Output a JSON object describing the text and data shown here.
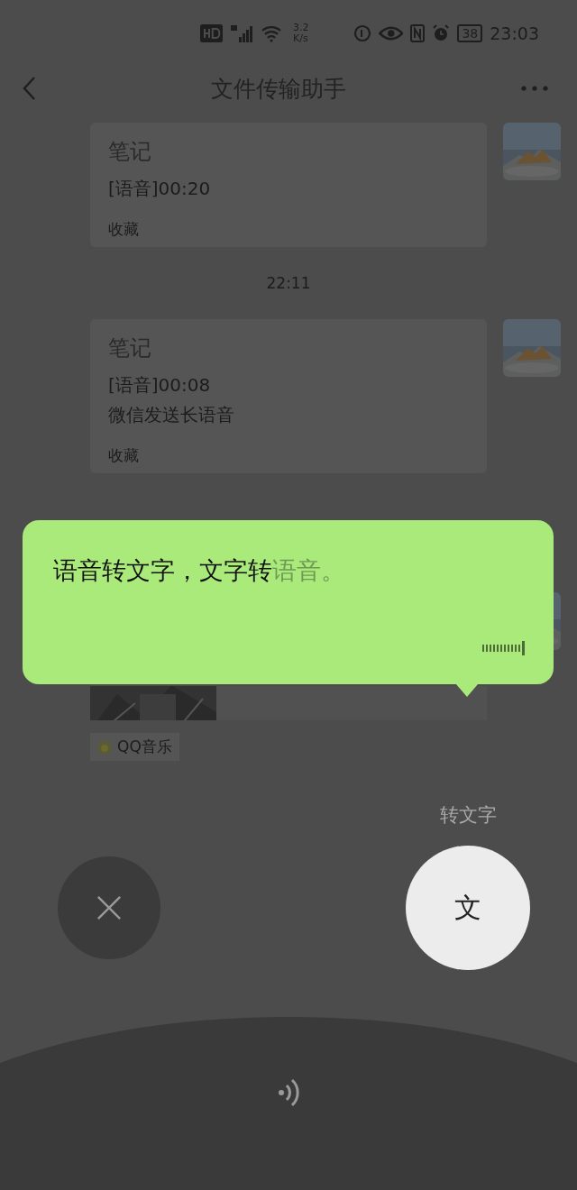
{
  "status_bar": {
    "speed": [
      "3.2",
      "K/s"
    ],
    "battery": "38",
    "time": "23:03"
  },
  "header": {
    "title": "文件传输助手"
  },
  "messages": [
    {
      "kind": "note",
      "title": "笔记",
      "lines": [
        "[语音]00:20"
      ],
      "footer": "收藏"
    },
    {
      "kind": "time",
      "text": "22:11"
    },
    {
      "kind": "note",
      "title": "笔记",
      "lines": [
        "[语音]00:08",
        "微信发送长语音"
      ],
      "footer": "收藏"
    },
    {
      "kind": "music",
      "source": "QQ音乐"
    }
  ],
  "voice_overlay": {
    "recognized": "语音转文字，文字转",
    "pending": "语音。",
    "convert_label": "转文字",
    "convert_button": "文"
  }
}
